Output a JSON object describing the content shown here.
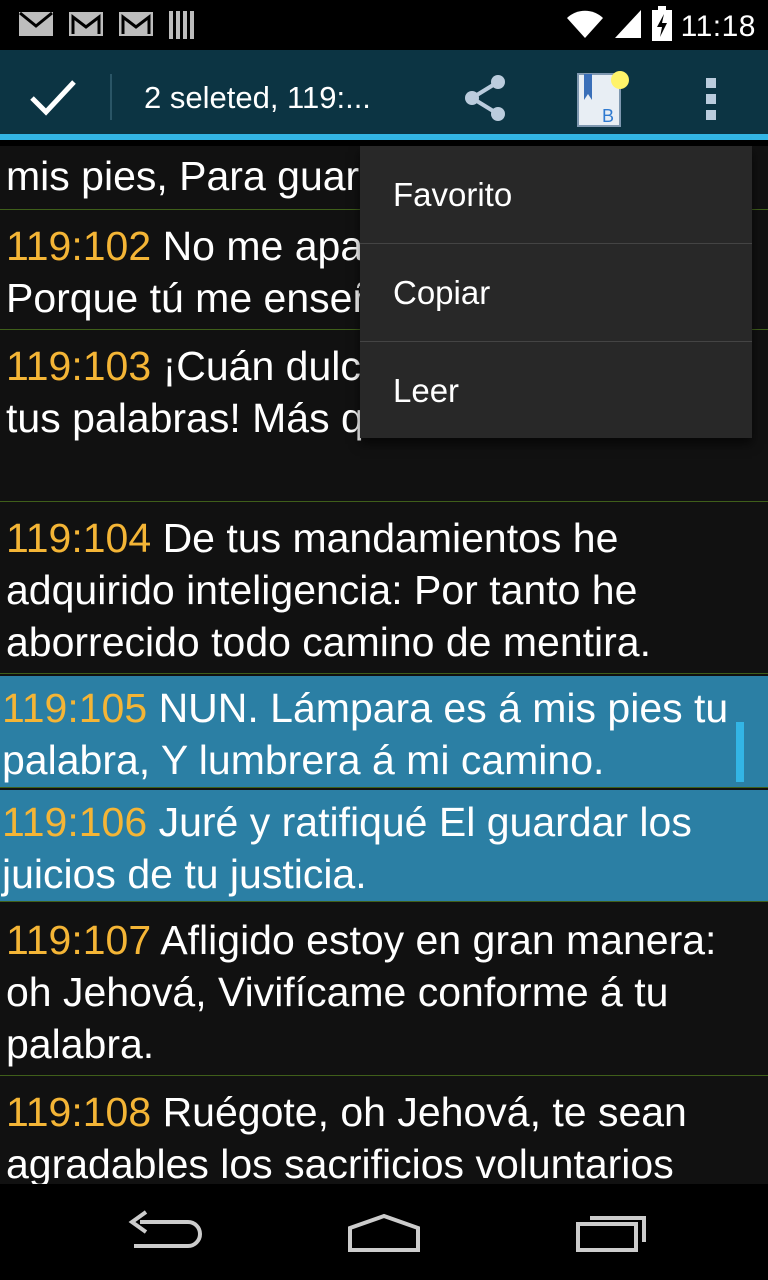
{
  "status_bar": {
    "time": "11:18",
    "notification_icons": [
      "mail-icon",
      "gmail-icon",
      "gmail-icon",
      "barcode-icon"
    ],
    "system_icons": [
      "wifi-icon",
      "signal-icon",
      "battery-charging-icon"
    ]
  },
  "action_bar": {
    "title": "2 seleted, 119:...",
    "icons": [
      "check-icon",
      "share-icon",
      "bible-bookmark-icon",
      "overflow-menu-icon"
    ]
  },
  "verses": [
    {
      "ref": "",
      "text": "mis pies, Para guardar tu palabra.",
      "selected": false
    },
    {
      "ref": "119:102",
      "text": "No me aparté de tus juicios; Porque tú me enseñaste.",
      "selected": false
    },
    {
      "ref": "119:103",
      "text": "¡Cuán dulces son á mi paladar tus palabras! Más que la miel á mi boca.",
      "selected": false
    },
    {
      "ref": "119:104",
      "text": "De tus mandamientos he adquirido inteligencia: Por tanto he aborrecido todo camino de mentira.",
      "selected": false
    },
    {
      "ref": "119:105",
      "text": "NUN. Lámpara es á mis pies tu palabra, Y lumbrera á mi camino.",
      "selected": true
    },
    {
      "ref": "119:106",
      "text": "Juré y ratifiqué El guardar los juicios de tu justicia.",
      "selected": true
    },
    {
      "ref": "119:107",
      "text": "Afligido estoy en gran manera: oh Jehová, Vivifícame conforme á tu palabra.",
      "selected": false
    },
    {
      "ref": "119:108",
      "text": "Ruégote, oh Jehová, te sean agradables los sacrificios voluntarios",
      "selected": false
    }
  ],
  "popup_menu": {
    "items": [
      "Favorito",
      "Copiar",
      "Leer"
    ]
  },
  "nav_bar": {
    "icons": [
      "back-icon",
      "home-icon",
      "recent-apps-icon"
    ]
  },
  "colors": {
    "action_bar": "#0c3443",
    "accent": "#33b5e5",
    "verse_ref": "#f4b536",
    "selected_bg": "#2b7fa4",
    "divider": "#3f5f1a"
  }
}
